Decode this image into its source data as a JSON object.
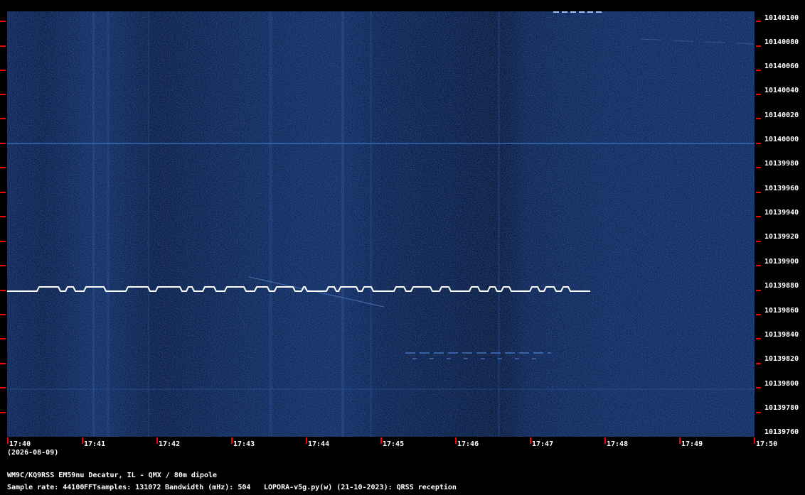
{
  "app": {
    "program": "LOPORA-v5g.py(w) (21-10-2023): QRSS reception"
  },
  "station": "WM9C/KQ9RSS EM59nu Decatur, IL - QMX / 80m dipole",
  "params": {
    "sample_rate_label": "Sample rate: 44100",
    "fft_label": "FFTsamples: 131072",
    "bandwidth_label": "Bandwidth (mHz): 504"
  },
  "time_axis": {
    "date": "(2026-08-09)",
    "ticks": [
      "17:40",
      "17:41",
      "17:42",
      "17:43",
      "17:44",
      "17:45",
      "17:46",
      "17:47",
      "17:48",
      "17:49",
      "17:50"
    ]
  },
  "freq_axis": {
    "ticks": [
      "10140100",
      "10140080",
      "10140060",
      "10140040",
      "10140020",
      "10140000",
      "10139980",
      "10139960",
      "10139940",
      "10139920",
      "10139900",
      "10139880",
      "10139860",
      "10139840",
      "10139820",
      "10139800",
      "10139780",
      "10139760"
    ]
  },
  "colors": {
    "background": "#000000",
    "waterfall_base": "#0f2a5c",
    "tick_mark": "#ff0000",
    "signal": "#ffffff",
    "faint_line": "#3f79c8"
  }
}
